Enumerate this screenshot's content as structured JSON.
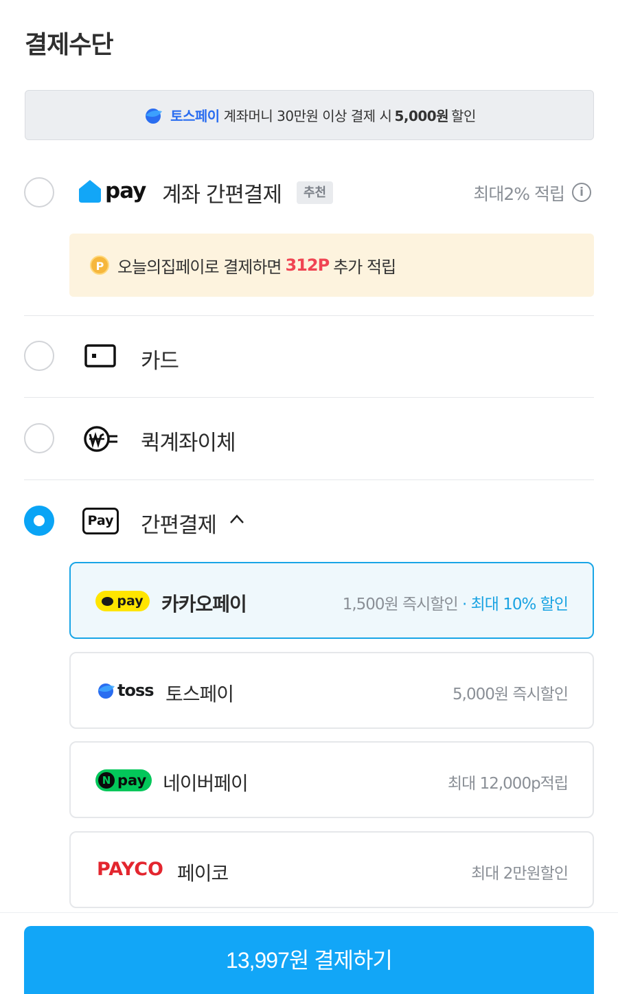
{
  "page": {
    "title": "결제수단"
  },
  "promo": {
    "brand": "토스페이",
    "text": "계좌머니 30만원 이상 결제 시",
    "amount": "5,000원",
    "suffix": "할인"
  },
  "methods": {
    "ohouse_pay": {
      "logo_text": "pay",
      "label": "계좌 간편결제",
      "badge": "추천",
      "reward": "최대2% 적립",
      "info_icon": "i",
      "point_icon": "P",
      "point_text_pre": "오늘의집페이로 결제하면",
      "point_amount": "312P",
      "point_text_post": "추가 적립"
    },
    "card": {
      "label": "카드"
    },
    "quick_transfer": {
      "label": "퀵계좌이체"
    },
    "easy_pay": {
      "icon_text": "Pay",
      "label": "간편결제"
    }
  },
  "easy_pay_options": {
    "kakao": {
      "logo_text": "pay",
      "name": "카카오페이",
      "benefit_main": "1,500원 즉시할인",
      "separator": "·",
      "benefit_accent": "최대 10% 할인"
    },
    "toss": {
      "logo_text": "toss",
      "name": "토스페이",
      "benefit_main": "5,000원 즉시할인"
    },
    "naver": {
      "logo_n": "N",
      "logo_text": "pay",
      "name": "네이버페이",
      "benefit_main": "최대 12,000p적립"
    },
    "payco": {
      "logo_text": "PAYCO",
      "name": "페이코",
      "benefit_main": "최대 2만원할인"
    }
  },
  "checkout": {
    "button_label": "13,997원 결제하기"
  },
  "colors": {
    "primary": "#12a6f7",
    "accent_red": "#f04452",
    "toss_blue": "#2a6df0",
    "kakao_yellow": "#ffe500",
    "naver_green": "#03c75a",
    "payco_red": "#e3262f"
  }
}
